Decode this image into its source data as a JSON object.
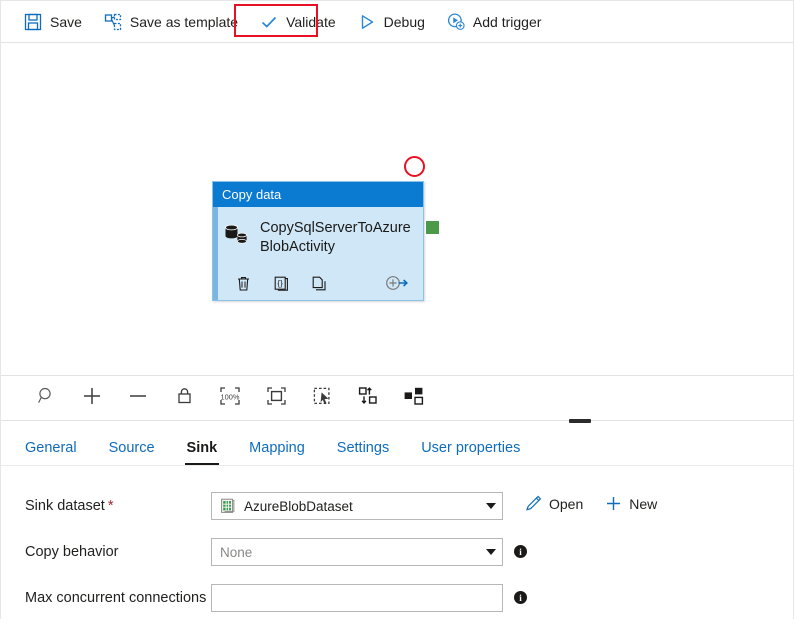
{
  "toolbar": {
    "items": [
      {
        "label": "Save",
        "icon": "save-icon"
      },
      {
        "label": "Save as template",
        "icon": "save-as-template-icon"
      },
      {
        "label": "Validate",
        "icon": "checkmark-icon"
      },
      {
        "label": "Debug",
        "icon": "play-triangle-icon"
      },
      {
        "label": "Add trigger",
        "icon": "add-trigger-icon"
      }
    ]
  },
  "annotations": {
    "validate_highlight_color": "#e81123",
    "node_circle_color": "#e81123"
  },
  "canvas": {
    "node": {
      "header": "Copy data",
      "title": "CopySqlServerToAzureBlobActivity",
      "icon": "copy-data-database-icon",
      "header_color": "#0b7ad1",
      "body_color": "#cfe7f7",
      "output_connector_color": "#4a9a4a",
      "actions": [
        {
          "name": "delete-activity",
          "icon": "trash-icon"
        },
        {
          "name": "view-code",
          "icon": "code-braces-icon"
        },
        {
          "name": "clone-activity",
          "icon": "duplicate-icon"
        },
        {
          "name": "add-output",
          "icon": "add-output-arrow-icon"
        }
      ]
    },
    "tools": [
      {
        "name": "zoom-tool",
        "icon": "magnifier-icon"
      },
      {
        "name": "zoom-in",
        "icon": "plus-icon"
      },
      {
        "name": "zoom-out",
        "icon": "minus-icon"
      },
      {
        "name": "lock-canvas",
        "icon": "lock-icon"
      },
      {
        "name": "zoom-100",
        "icon": "zoom-100-icon",
        "label": "100%"
      },
      {
        "name": "fit-to-screen",
        "icon": "fit-screen-icon"
      },
      {
        "name": "select-region",
        "icon": "select-region-icon"
      },
      {
        "name": "auto-align",
        "icon": "auto-align-icon"
      },
      {
        "name": "auto-layout",
        "icon": "auto-layout-icon"
      }
    ]
  },
  "tabs": [
    {
      "label": "General",
      "active": false
    },
    {
      "label": "Source",
      "active": false
    },
    {
      "label": "Sink",
      "active": true
    },
    {
      "label": "Mapping",
      "active": false
    },
    {
      "label": "Settings",
      "active": false
    },
    {
      "label": "User properties",
      "active": false
    }
  ],
  "form": {
    "sink_dataset": {
      "label": "Sink dataset",
      "required_marker": "*",
      "value": "AzureBlobDataset",
      "icon": "dataset-file-icon",
      "open_label": "Open",
      "new_label": "New"
    },
    "copy_behavior": {
      "label": "Copy behavior",
      "value": "None",
      "is_placeholder": true,
      "info": "i"
    },
    "max_concurrent_connections": {
      "label": "Max concurrent connections",
      "value": "",
      "placeholder": "",
      "info": "i"
    }
  }
}
